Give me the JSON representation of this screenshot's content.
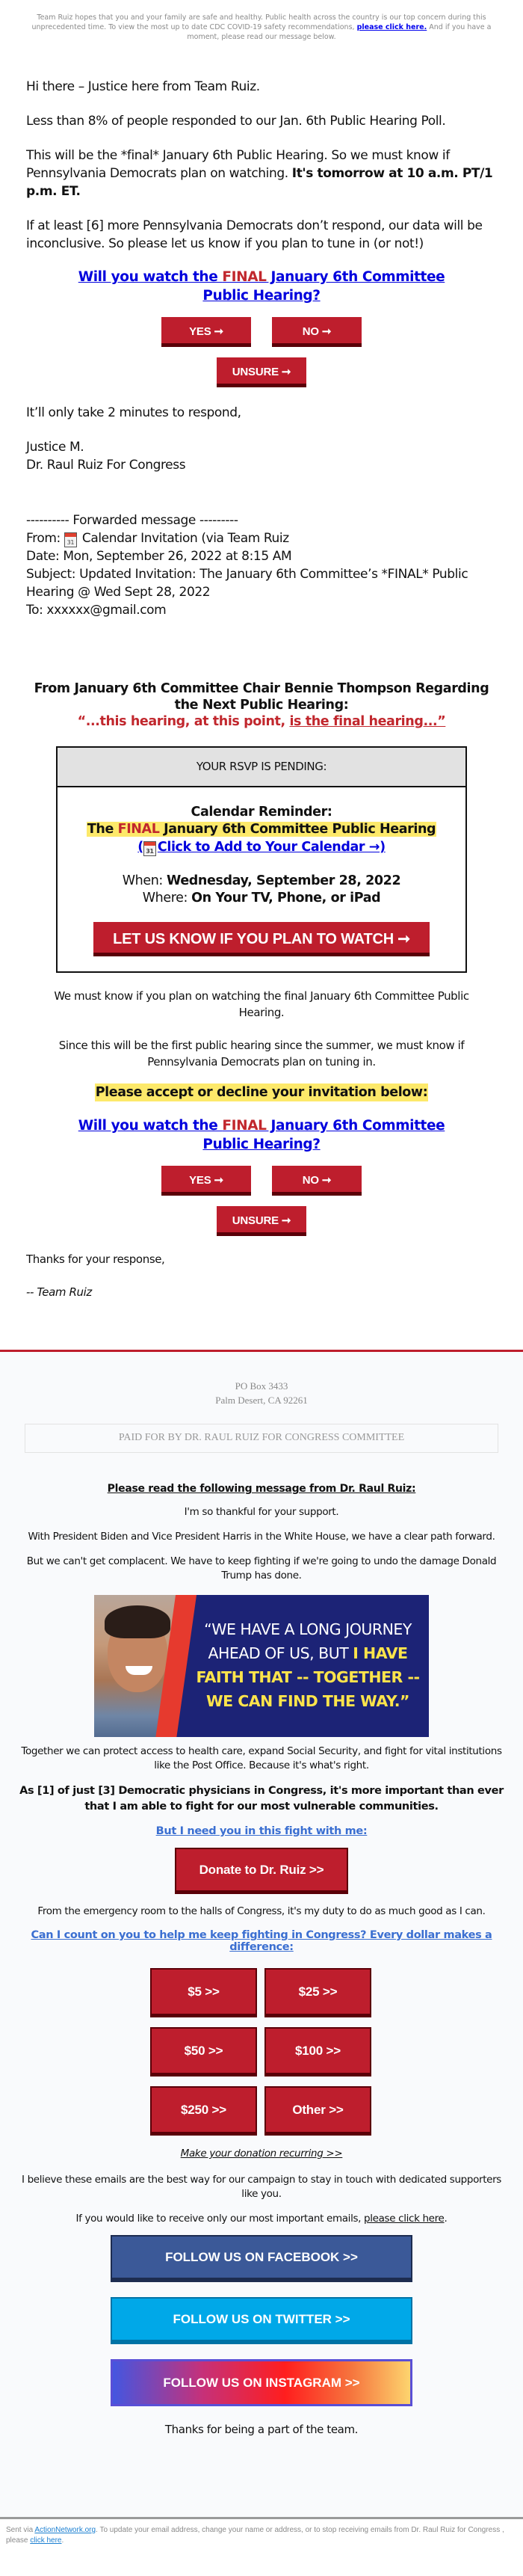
{
  "top_notice": {
    "text_before": "Team Ruiz hopes that you and your family are safe and healthy. Public health across the country is our top concern during this unprecedented time. To view the most up to date CDC COVID-19 safety recommendations, ",
    "link_label": "please click here.",
    "text_after": " And if you have a moment, please read our message below."
  },
  "intro": {
    "greeting": "Hi there – Justice here from Team Ruiz.",
    "poll": "Less than 8% of people responded to our Jan. 6th Public Hearing Poll.",
    "final_para": "This will be the *final* January 6th Public Hearing. So we must know if Pennsylvania Democrats plan on watching. ",
    "final_para_bold": "It's tomorrow at 10 a.m. PT/1 p.m. ET.",
    "inconclusive": "If at least [6] more Pennsylvania Democrats don’t respond, our data will be inconclusive. So please let us know if you plan to tune in (or not!)"
  },
  "question": {
    "before": "Will you watch the ",
    "final_word": "FINAL",
    "after": " January 6th Committee Public Hearing?"
  },
  "rsvp_buttons": {
    "yes": "YES ➞",
    "no": "NO ➞",
    "unsure": "UNSURE ➞"
  },
  "respond_line": "It’ll only take 2 minutes to respond,",
  "signature": {
    "name": "Justice M.",
    "org": "Dr. Raul Ruiz For Congress"
  },
  "forwarded": {
    "header": "---------- Forwarded message ---------",
    "from_label": "From: ",
    "calendar_icon_day": "31",
    "from_value": " Calendar Invitation (via Team Ruiz",
    "date": "Date: Mon, September 26, 2022 at 8:15 AM",
    "subject": "Subject: Updated Invitation: The January 6th Committee’s *FINAL* Public Hearing @ Wed Sept 28, 2022",
    "to": "To: xxxxxx@gmail.com"
  },
  "chair": {
    "heading": "From January 6th Committee Chair Bennie Thompson Regarding the Next Public Hearing:",
    "quote_plain": "“...this hearing, at this point, ",
    "quote_underlined": "is the final hearing...”"
  },
  "rsvp_box": {
    "status": "YOUR RSVP IS PENDING:",
    "reminder_label": "Calendar Reminder:",
    "title_before": "The ",
    "title_final": "FINAL",
    "title_after": " January 6th Committee Public Hearing",
    "add_link_open": "(",
    "add_link_label": "Click to Add to Your Calendar →",
    "add_link_close": ")",
    "when_label": "When: ",
    "when_value": "Wednesday, September 28, 2022",
    "where_label": "Where: ",
    "where_value": "On Your TV, Phone, or iPad",
    "cta": "LET US KNOW IF YOU PLAN TO WATCH ➞"
  },
  "middle": {
    "must_know": "We must know if you plan on watching the final January 6th Committee Public Hearing.",
    "first_hearing": "Since this will be the first public hearing since the summer, we must know if Pennsylvania Democrats plan on tuning in.",
    "accept_decline": "Please accept or decline your invitation below:"
  },
  "closing": {
    "thanks": "Thanks for your response,",
    "team": "-- Team Ruiz"
  },
  "footer": {
    "address_line1": "PO Box 3433",
    "address_line2": "Palm Desert, CA 92261",
    "paid_for": "PAID FOR BY DR. RAUL RUIZ FOR CONGRESS COMMITTEE",
    "message_heading": "Please read the following message from Dr. Raul Ruiz:",
    "thankful": "I'm so thankful for your support.",
    "biden": "With President Biden and Vice President Harris in the White House, we have a clear path forward.",
    "complacent": "But we can't get complacent. We have to keep fighting if we're going to undo the damage Donald Trump has done.",
    "banner": {
      "line1": "“WE HAVE A LONG JOURNEY",
      "line2_white": "AHEAD OF US, BUT ",
      "line2_yellow": "I HAVE",
      "line3": "FAITH THAT -- TOGETHER --",
      "line4": "WE CAN FIND THE WAY.”"
    },
    "together": "Together we can protect access to health care, expand Social Security, and fight for vital institutions like the Post Office. Because it's what's right.",
    "physicians": "As [1] of just [3] Democratic physicians in Congress, it's more important than ever that I am able to fight for our most vulnerable communities.",
    "need_you": "But I need you in this fight with me:",
    "donate_button": "Donate to Dr. Ruiz >>",
    "emergency": "From the emergency room to the halls of Congress, it's my duty to do as much good as I can.",
    "count_on_you": "Can I count on you to help me keep fighting in Congress? Every dollar makes a difference:",
    "amounts": [
      "$5 >>",
      "$25 >>",
      "$50 >>",
      "$100 >>",
      "$250 >>",
      "Other >>"
    ],
    "recurring": "Make your donation recurring >>",
    "best_way": "I believe these emails are the best way for our campaign to stay in touch with dedicated supporters like you.",
    "important_before": "If you would like to receive only our most important emails, ",
    "important_link": "please click here",
    "important_after": ".",
    "social": {
      "facebook": "FOLLOW US ON FACEBOOK >>",
      "twitter": "FOLLOW US ON TWITTER >>",
      "instagram": "FOLLOW US ON INSTAGRAM >>"
    },
    "thanks_team": "Thanks for being a part of the team."
  },
  "legal": {
    "sent_via": "Sent via ",
    "network_link": "ActionNetwork.org",
    "middle": ". To update your email address, change your name or address, or to stop receiving emails from Dr. Raul Ruiz for Congress , please ",
    "click_link": "click here",
    "end": "."
  },
  "colors": {
    "brand_red": "#be1e2d",
    "brand_dark_red": "#5a0008",
    "link_blue": "#0000dd",
    "highlight_yellow": "#fde96a",
    "facebook_blue": "#3b5998",
    "twitter_blue": "#00a8e8"
  }
}
